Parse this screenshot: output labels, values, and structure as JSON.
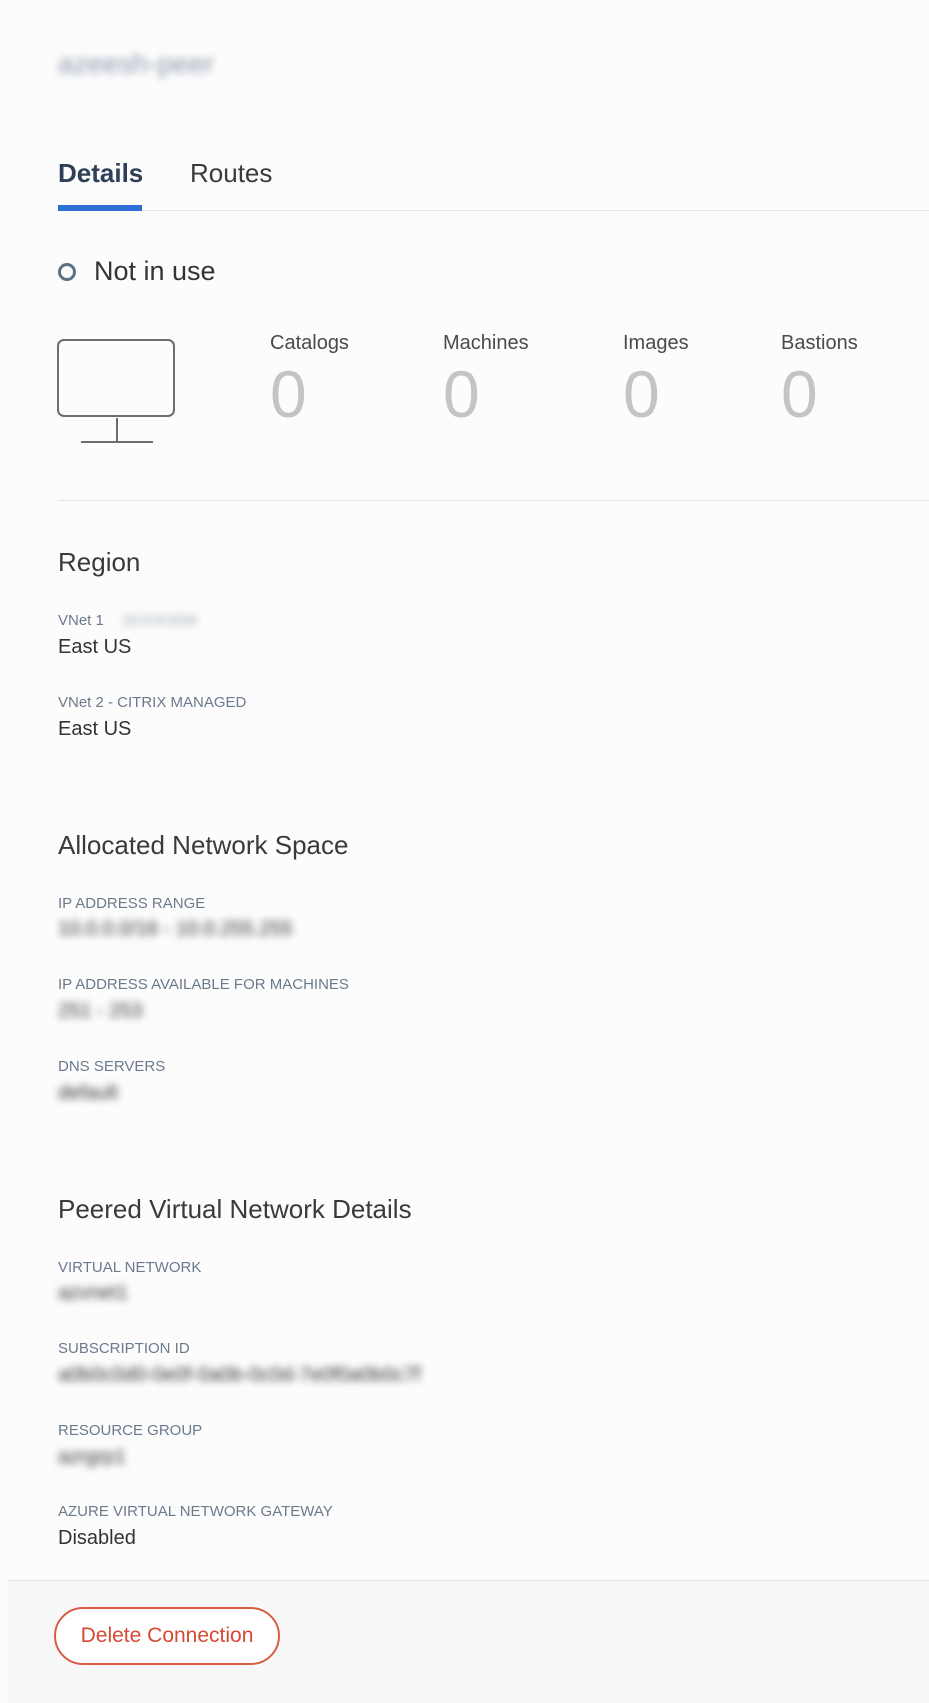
{
  "header": {
    "title": "azeesh-peer"
  },
  "tabs": [
    {
      "label": "Details",
      "active": true
    },
    {
      "label": "Routes",
      "active": false
    }
  ],
  "status": {
    "text": "Not in use"
  },
  "stats": [
    {
      "label": "Catalogs",
      "value": "0"
    },
    {
      "label": "Machines",
      "value": "0"
    },
    {
      "label": "Images",
      "value": "0"
    },
    {
      "label": "Bastions",
      "value": "0"
    }
  ],
  "region": {
    "title": "Region",
    "vnet1": {
      "label": "VNet 1",
      "extra": "10.0.0.0/16",
      "value": "East US"
    },
    "vnet2": {
      "label": "VNet 2 - CITRIX MANAGED",
      "value": "East US"
    }
  },
  "network_space": {
    "title": "Allocated Network Space",
    "ip_range": {
      "label": "IP ADDRESS RANGE",
      "value": "10.0.0.0/16 - 10.0.255.255"
    },
    "ip_available": {
      "label": "IP ADDRESS AVAILABLE FOR MACHINES",
      "value": "251 - 253"
    },
    "dns": {
      "label": "DNS SERVERS",
      "value": "default"
    }
  },
  "peered": {
    "title": "Peered Virtual Network Details",
    "virtual_network": {
      "label": "VIRTUAL NETWORK",
      "value": "azvnet1"
    },
    "subscription": {
      "label": "SUBSCRIPTION ID",
      "value": "a0b0c0d0-0e0f-0a0b-0c0d-7e0f0a0b0c7f"
    },
    "resource_group": {
      "label": "RESOURCE GROUP",
      "value": "azrgrp1"
    },
    "gateway": {
      "label": "AZURE VIRTUAL NETWORK GATEWAY",
      "value": "Disabled"
    }
  },
  "footer": {
    "delete_label": "Delete Connection"
  },
  "colors": {
    "accent": "#2f6fd6",
    "danger": "#d44a33",
    "muted": "#c4c4c4"
  },
  "icons": {
    "status": "circle-outline-icon",
    "machine": "monitor-icon"
  }
}
